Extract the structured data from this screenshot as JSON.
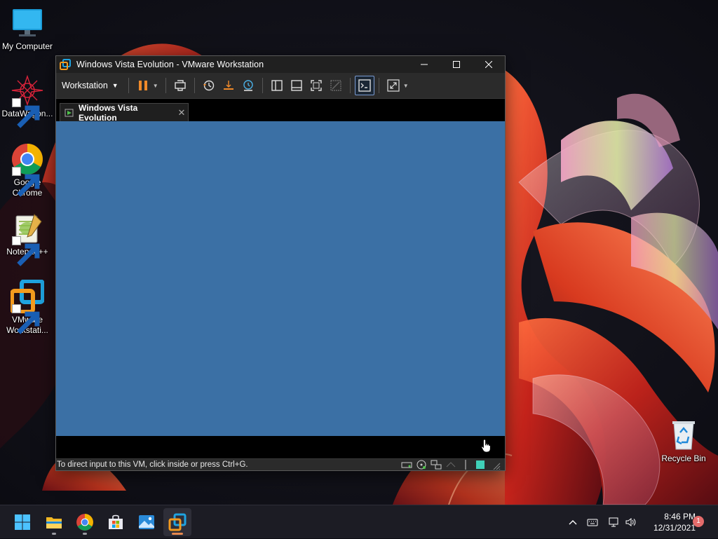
{
  "desktop": {
    "icons": [
      {
        "label": "My Computer",
        "icon": "monitor-icon"
      },
      {
        "label": "DataWagon...",
        "icon": "datawagon-icon"
      },
      {
        "label": "Google Chrome",
        "icon": "chrome-icon"
      },
      {
        "label": "Notepad++",
        "icon": "notepadpp-icon"
      },
      {
        "label": "VMware Workstati...",
        "icon": "vmware-icon"
      },
      {
        "label": "Recycle Bin",
        "icon": "recycle-bin-icon"
      }
    ]
  },
  "window": {
    "title": "Windows Vista Evolution - VMware Workstation",
    "controls": {
      "minimize": "—",
      "maximize": "☐",
      "close": "✕"
    },
    "toolbar": {
      "menu_label": "Workstation",
      "buttons": [
        "pause-icon",
        "send-ctrl-alt-del-icon",
        "snapshot-revert-icon",
        "snapshot-take-icon",
        "snapshot-manager-icon",
        "show-library-icon",
        "thumbnail-bar-icon",
        "full-screen-icon",
        "unity-icon",
        "console-view-icon",
        "stretch-guest-icon"
      ]
    },
    "tab": {
      "label": "Windows Vista Evolution",
      "close": "✕"
    },
    "vm_screen_color": "#3b70a5",
    "status_text": "To direct input to this VM, click inside or press Ctrl+G."
  },
  "taskbar": {
    "apps": [
      "start-icon",
      "file-explorer-icon",
      "chrome-icon",
      "store-icon",
      "photos-icon",
      "vmware-icon"
    ],
    "active_app": "vmware-icon",
    "tray": [
      "show-hidden-icons-icon",
      "keyboard-icon",
      "network-icon",
      "volume-icon"
    ],
    "time": "8:46 PM",
    "date": "12/31/2021",
    "notification_count": "1"
  },
  "colors": {
    "accent": "#e6884f",
    "vm_blue": "#3b70a5",
    "titlebar": "#202020"
  }
}
